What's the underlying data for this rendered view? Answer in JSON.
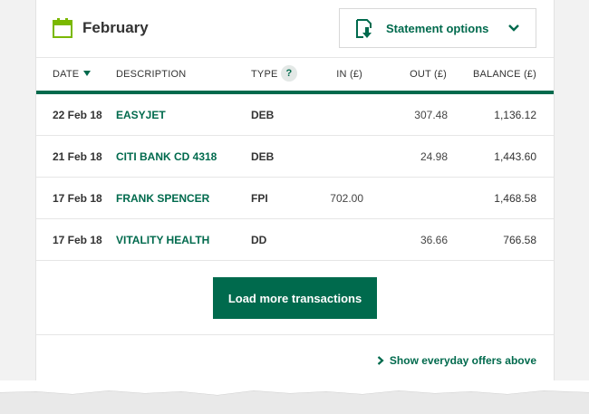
{
  "header": {
    "month": "February",
    "statement_options_label": "Statement options",
    "icons": {
      "calendar": "calendar-icon",
      "statement": "download-statement-icon",
      "chevron": "chevron-down-icon"
    }
  },
  "table": {
    "columns": {
      "date": "DATE",
      "description": "DESCRIPTION",
      "type": "TYPE",
      "type_help": "?",
      "in": "IN (£)",
      "out": "OUT (£)",
      "balance": "BALANCE (£)"
    },
    "rows": [
      {
        "date": "22 Feb 18",
        "description": "EASYJET",
        "type": "DEB",
        "in": "",
        "out": "307.48",
        "balance": "1,136.12"
      },
      {
        "date": "21 Feb 18",
        "description": "CITI BANK CD 4318",
        "type": "DEB",
        "in": "",
        "out": "24.98",
        "balance": "1,443.60"
      },
      {
        "date": "17 Feb 18",
        "description": "FRANK SPENCER",
        "type": "FPI",
        "in": "702.00",
        "out": "",
        "balance": "1,468.58"
      },
      {
        "date": "17 Feb 18",
        "description": "VITALITY HEALTH",
        "type": "DD",
        "in": "",
        "out": "36.66",
        "balance": "766.58"
      }
    ]
  },
  "load_more_label": "Load more transactions",
  "offers_link_label": "Show everyday offers above",
  "colors": {
    "brand_green": "#006a4d",
    "calendar_green": "#7ab800"
  }
}
